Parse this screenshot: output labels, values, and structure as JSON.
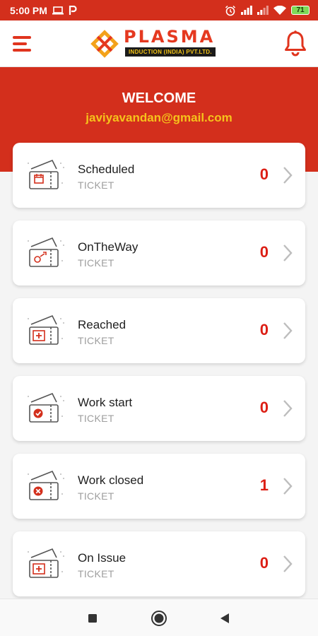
{
  "status_bar": {
    "time": "5:00 PM",
    "battery": "71"
  },
  "header": {
    "logo_text": "PLASMA",
    "logo_subtitle": "INDUCTION (INDIA) PVT.LTD."
  },
  "welcome": {
    "title": "WELCOME",
    "email": "javiyavandan@gmail.com"
  },
  "tickets": [
    {
      "title": "Scheduled",
      "subtitle": "TICKET",
      "count": "0"
    },
    {
      "title": "OnTheWay",
      "subtitle": "TICKET",
      "count": "0"
    },
    {
      "title": "Reached",
      "subtitle": "TICKET",
      "count": "0"
    },
    {
      "title": "Work start",
      "subtitle": "TICKET",
      "count": "0"
    },
    {
      "title": "Work closed",
      "subtitle": "TICKET",
      "count": "1"
    },
    {
      "title": "On Issue",
      "subtitle": "TICKET",
      "count": "0"
    }
  ],
  "colors": {
    "brand_red": "#d32f1c",
    "accent_yellow": "#f6c21b",
    "count_red": "#dc1e14"
  },
  "icons": {
    "status_bar": [
      "laptop-icon",
      "p-app-icon",
      "alarm-icon",
      "signal-icon",
      "wifi-icon",
      "battery-icon"
    ],
    "tickets": [
      "calendar-ticket-icon",
      "delivery-ticket-icon",
      "medical-ticket-icon",
      "check-ticket-icon",
      "close-ticket-icon",
      "medical-ticket-icon"
    ]
  }
}
